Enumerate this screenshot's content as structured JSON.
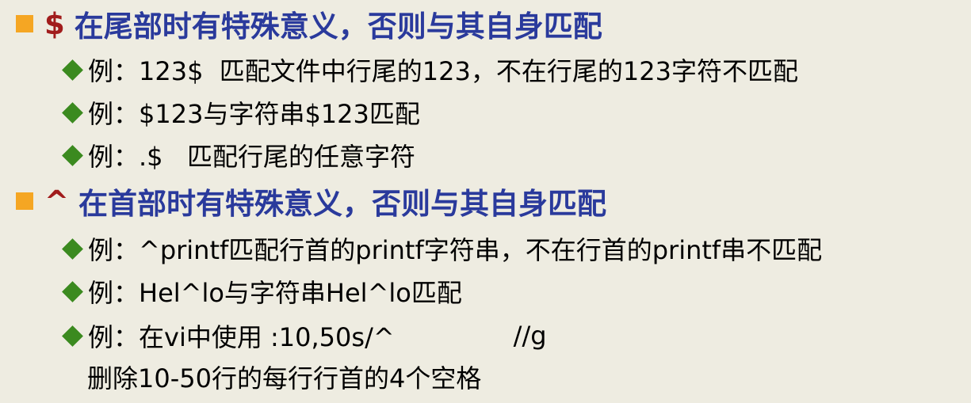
{
  "sections": [
    {
      "symbol": "$",
      "heading": "在尾部时有特殊意义，否则与其自身匹配",
      "examples": [
        "例：123$  匹配文件中行尾的123，不在行尾的123字符不匹配",
        "例：$123与字符串$123匹配",
        "例：.$   匹配行尾的任意字符"
      ]
    },
    {
      "symbol": "^",
      "heading": "在首部时有特殊意义，否则与其自身匹配",
      "examples": [
        "例：^printf匹配行首的printf字符串，不在行首的printf串不匹配",
        "例：Hel^lo与字符串Hel^lo匹配"
      ],
      "vi_example": {
        "command_start": "例：在vi中使用 :10,50s/^",
        "command_end": "//g",
        "continuation": "删除10-50行的每行行首的4个空格"
      }
    }
  ],
  "colors": {
    "background": "#eeece1",
    "heading": "#2a3a9c",
    "symbol": "#a11c1c",
    "square_bullet": "#f5a623",
    "diamond_bullet": "#3b8a1f"
  },
  "icons": {
    "level1_bullet": "orange-square-icon",
    "level2_bullet": "green-diamond-icon"
  }
}
